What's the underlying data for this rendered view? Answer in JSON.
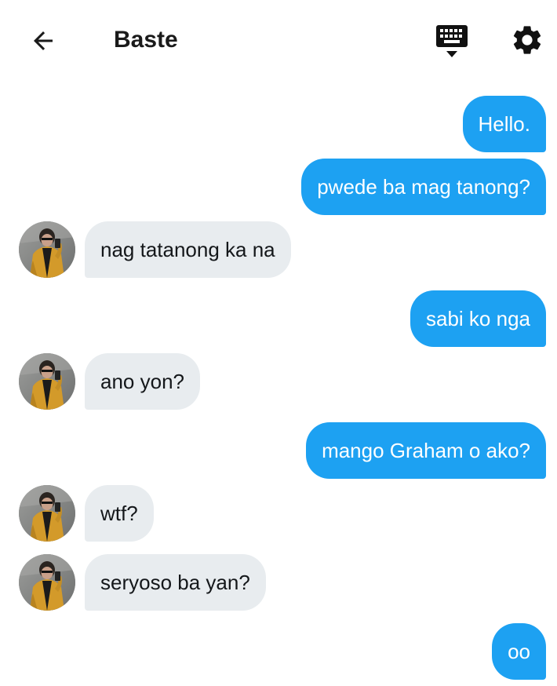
{
  "header": {
    "title": "Baste",
    "back_icon": "arrow-left-icon",
    "keyboard_icon": "keyboard-hide-icon",
    "settings_icon": "gear-icon"
  },
  "colors": {
    "outgoing_bubble": "#1da1f2",
    "incoming_bubble": "#e8ecef",
    "text_dark": "#14171a"
  },
  "messages": [
    {
      "from": "me",
      "text": "Hello."
    },
    {
      "from": "me",
      "text": "pwede ba mag tanong?"
    },
    {
      "from": "them",
      "text": "nag tatanong ka na"
    },
    {
      "from": "me",
      "text": "sabi ko nga"
    },
    {
      "from": "them",
      "text": "ano yon?"
    },
    {
      "from": "me",
      "text": "mango Graham o ako?"
    },
    {
      "from": "them",
      "text": "wtf?"
    },
    {
      "from": "them",
      "text": "seryoso ba yan?"
    },
    {
      "from": "me",
      "text": "oo"
    }
  ]
}
